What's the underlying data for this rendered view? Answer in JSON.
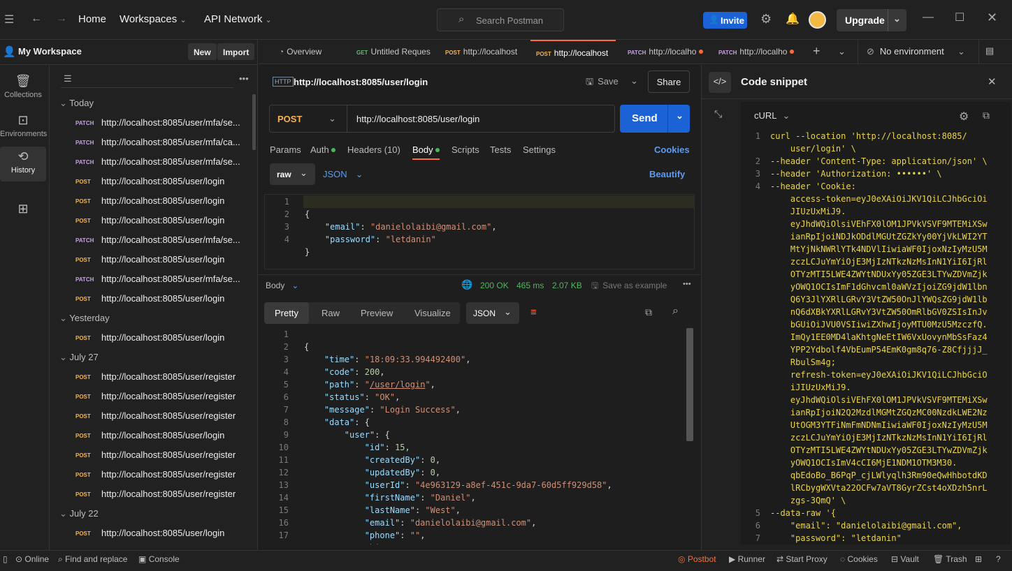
{
  "topbar": {
    "home": "Home",
    "workspaces": "Workspaces",
    "api_network": "API Network",
    "search_placeholder": "Search Postman",
    "invite": "Invite",
    "upgrade": "Upgrade"
  },
  "sidebar": {
    "workspace_name": "My Workspace",
    "new": "New",
    "import": "Import",
    "rail": [
      {
        "label": "Collections"
      },
      {
        "label": "Environments"
      },
      {
        "label": "History"
      }
    ],
    "groups": [
      {
        "label": "Today",
        "items": [
          {
            "method": "PATCH",
            "url": "http://localhost:8085/user/mfa/se..."
          },
          {
            "method": "PATCH",
            "url": "http://localhost:8085/user/mfa/ca..."
          },
          {
            "method": "PATCH",
            "url": "http://localhost:8085/user/mfa/se..."
          },
          {
            "method": "POST",
            "url": "http://localhost:8085/user/login"
          },
          {
            "method": "POST",
            "url": "http://localhost:8085/user/login"
          },
          {
            "method": "POST",
            "url": "http://localhost:8085/user/login"
          },
          {
            "method": "PATCH",
            "url": "http://localhost:8085/user/mfa/se..."
          },
          {
            "method": "POST",
            "url": "http://localhost:8085/user/login"
          },
          {
            "method": "PATCH",
            "url": "http://localhost:8085/user/mfa/se..."
          },
          {
            "method": "POST",
            "url": "http://localhost:8085/user/login"
          }
        ]
      },
      {
        "label": "Yesterday",
        "items": [
          {
            "method": "POST",
            "url": "http://localhost:8085/user/login"
          }
        ]
      },
      {
        "label": "July 27",
        "items": [
          {
            "method": "POST",
            "url": "http://localhost:8085/user/register"
          },
          {
            "method": "POST",
            "url": "http://localhost:8085/user/register"
          },
          {
            "method": "POST",
            "url": "http://localhost:8085/user/register"
          },
          {
            "method": "POST",
            "url": "http://localhost:8085/user/login"
          },
          {
            "method": "POST",
            "url": "http://localhost:8085/user/register"
          },
          {
            "method": "POST",
            "url": "http://localhost:8085/user/register"
          },
          {
            "method": "POST",
            "url": "http://localhost:8085/user/register"
          }
        ]
      },
      {
        "label": "July 22",
        "items": [
          {
            "method": "POST",
            "url": "http://localhost:8085/user/login"
          }
        ]
      }
    ]
  },
  "tabs": [
    {
      "method": "",
      "label": "Overview"
    },
    {
      "method": "GET",
      "label": "Untitled Reques"
    },
    {
      "method": "POST",
      "label": "http://localhost"
    },
    {
      "method": "POST",
      "label": "http://localhost",
      "active": true
    },
    {
      "method": "PATCH",
      "label": "http://localho",
      "dirty": true
    },
    {
      "method": "PATCH",
      "label": "http://localho",
      "dirty": true
    }
  ],
  "environment": "No environment",
  "request": {
    "title": "http://localhost:8085/user/login",
    "save": "Save",
    "share": "Share",
    "method": "POST",
    "url": "http://localhost:8085/user/login",
    "send": "Send",
    "subtabs": {
      "params": "Params",
      "auth": "Auth",
      "headers": "Headers (10)",
      "body": "Body",
      "scripts": "Scripts",
      "tests": "Tests",
      "settings": "Settings",
      "cookies": "Cookies"
    },
    "body_mode": "raw",
    "body_lang": "JSON",
    "beautify": "Beautify",
    "body_lines": [
      "{",
      "    \"email\": \"danielolaibi@gmail.com\",",
      "    \"password\": \"letdanin\"",
      "}"
    ]
  },
  "response": {
    "label": "Body",
    "status": "200 OK",
    "time": "465 ms",
    "size": "2.07 KB",
    "save_example": "Save as example",
    "views": {
      "pretty": "Pretty",
      "raw": "Raw",
      "preview": "Preview",
      "visualize": "Visualize",
      "format": "JSON"
    },
    "lines": [
      "{",
      "    \"time\": \"18:09:33.994492400\",",
      "    \"code\": 200,",
      "    \"path\": \"/user/login\",",
      "    \"status\": \"OK\",",
      "    \"message\": \"Login Success\",",
      "    \"data\": {",
      "        \"user\": {",
      "            \"id\": 15,",
      "            \"createdBy\": 0,",
      "            \"updatedBy\": 0,",
      "            \"userId\": \"4e963129-a8ef-451c-9da7-60d5ff929d58\",",
      "            \"firstName\": \"Daniel\",",
      "            \"lastName\": \"West\",",
      "            \"email\": \"danielolaibi@gmail.com\",",
      "            \"phone\": \"\",",
      "            \"bio\": \"\","
    ]
  },
  "snippet": {
    "title": "Code snippet",
    "lang": "cURL",
    "lines": [
      {
        "n": "1",
        "t": "curl --location 'http://localhost:8085/"
      },
      {
        "n": "",
        "t": "    user/login' \\"
      },
      {
        "n": "2",
        "t": "--header 'Content-Type: application/json' \\"
      },
      {
        "n": "3",
        "t": "--header 'Authorization: ••••••' \\"
      },
      {
        "n": "4",
        "t": "--header 'Cookie:"
      },
      {
        "n": "",
        "t": "    access-token=eyJ0eXAiOiJKV1QiLCJhbGciOi"
      },
      {
        "n": "",
        "t": "    JIUzUxMiJ9."
      },
      {
        "n": "",
        "t": "    eyJhdWQiOlsiVEhFX0lOM1JPVkVSVF9MTEMiXSw"
      },
      {
        "n": "",
        "t": "    ianRpIjoiNDJkODdlMGUtZGZkYy00YjVkLWI2YT"
      },
      {
        "n": "",
        "t": "    MtYjNkNWRlYTk4NDVlIiwiaWF0IjoxNzIyMzU5M"
      },
      {
        "n": "",
        "t": "    zczLCJuYmYiOjE3MjIzNTkzNzMsInN1YiI6IjRl"
      },
      {
        "n": "",
        "t": "    OTYzMTI5LWE4ZWYtNDUxYy05ZGE3LTYwZDVmZjk"
      },
      {
        "n": "",
        "t": "    yOWQ1OCIsImF1dGhvcml0aWVzIjoiZG9jdW1lbn"
      },
      {
        "n": "",
        "t": "    Q6Y3JlYXRlLGRvY3VtZW50OnJlYWQsZG9jdW1lb"
      },
      {
        "n": "",
        "t": "    nQ6dXBkYXRlLGRvY3VtZW50OmRlbGV0ZSIsInJv"
      },
      {
        "n": "",
        "t": "    bGUiOiJVU0VSIiwiZXhwIjoyMTU0MzU5MzczfQ."
      },
      {
        "n": "",
        "t": "    ImQy1EE0MD4laKhtgNeEtIW6VxUovynMbSsFaz4"
      },
      {
        "n": "",
        "t": "    YPP2Ydbolf4VbEumP54EmK0gm8q76-Z8CfjjjJ_"
      },
      {
        "n": "",
        "t": "    RbulSm4g;"
      },
      {
        "n": "",
        "t": "    refresh-token=eyJ0eXAiOiJKV1QiLCJhbGciO"
      },
      {
        "n": "",
        "t": "    iJIUzUxMiJ9."
      },
      {
        "n": "",
        "t": "    eyJhdWQiOlsiVEhFX0lOM1JPVkVSVF9MTEMiXSw"
      },
      {
        "n": "",
        "t": "    ianRpIjoiN2Q2MzdlMGMtZGQzMC00NzdkLWE2Nz"
      },
      {
        "n": "",
        "t": "    UtOGM3YTFiNmFmNDNmIiwiaWF0IjoxNzIyMzU5M"
      },
      {
        "n": "",
        "t": "    zczLCJuYmYiOjE3MjIzNTkzNzMsInN1YiI6IjRl"
      },
      {
        "n": "",
        "t": "    OTYzMTI5LWE4ZWYtNDUxYy05ZGE3LTYwZDVmZjk"
      },
      {
        "n": "",
        "t": "    yOWQ1OCIsImV4cCI6MjE1NDM1OTM3M30."
      },
      {
        "n": "",
        "t": "    qbEdoBo_B6PqP_cjLWlyqlh3Rm90eQwHhbotdKD"
      },
      {
        "n": "",
        "t": "    lRCbygWXVta22OCFw7aVT8GyrZCst4oXDzh5nrL"
      },
      {
        "n": "",
        "t": "    zgs-3QmQ' \\"
      },
      {
        "n": "5",
        "t": "--data-raw '{"
      },
      {
        "n": "6",
        "t": "    \"email\": \"danielolaibi@gmail.com\","
      },
      {
        "n": "7",
        "t": "    \"password\": \"letdanin\""
      }
    ]
  },
  "statusbar": {
    "online": "Online",
    "find": "Find and replace",
    "console": "Console",
    "postbot": "Postbot",
    "runner": "Runner",
    "proxy": "Start Proxy",
    "cookies": "Cookies",
    "vault": "Vault",
    "trash": "Trash"
  }
}
